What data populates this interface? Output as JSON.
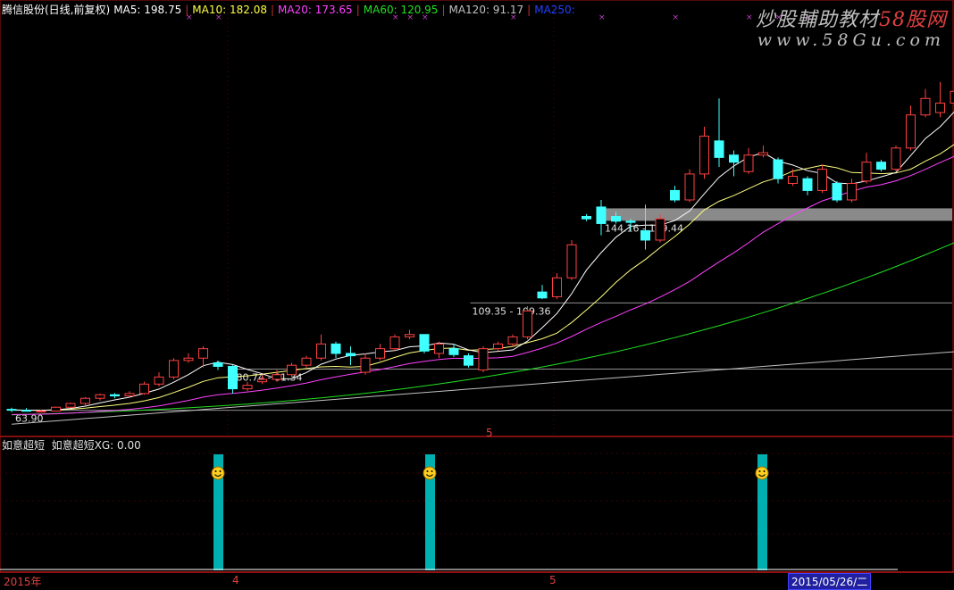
{
  "header": {
    "stock": "腾信股份(日线,前复权)",
    "ma": [
      {
        "label": "MA5: 198.75",
        "color": "#ffffff"
      },
      {
        "label": "MA10: 182.08",
        "color": "#ffff40"
      },
      {
        "label": "MA20: 173.65",
        "color": "#ff40ff"
      },
      {
        "label": "MA60: 120.95",
        "color": "#20e020"
      },
      {
        "label": "MA120: 91.17",
        "color": "#c0c0c0"
      },
      {
        "label": "MA250:",
        "color": "#2040ff"
      }
    ]
  },
  "indicator": {
    "title": "如意超短",
    "value_label": "如意超短XG: 0.00"
  },
  "watermark": {
    "line1_a": "炒股輔助教材",
    "line1_b": "58股网",
    "line2": "www.58Gu.com"
  },
  "x_axis": {
    "year": "2015年",
    "m4": "4",
    "m5": "5",
    "m5_top": "5",
    "date": "2015/05/26/二"
  },
  "colors": {
    "up": "#ff4040",
    "down": "#40ffff",
    "ma5": "#ffffff",
    "ma10": "#ffff80",
    "ma20": "#ff40ff",
    "ma60": "#20e020",
    "ma120": "#c0c0c0",
    "signal": "#00b0b0"
  },
  "chart_data": {
    "type": "candlestick",
    "price_range": [
      60,
      215
    ],
    "candles": [
      {
        "o": 64.3,
        "h": 65,
        "l": 63.1,
        "c": 64.0
      },
      {
        "o": 63.9,
        "h": 64.8,
        "l": 63.5,
        "c": 63.8
      },
      {
        "o": 63.2,
        "h": 64.2,
        "l": 63.0,
        "c": 63.6
      },
      {
        "o": 63.6,
        "h": 65.5,
        "l": 63.5,
        "c": 65.2
      },
      {
        "o": 65.2,
        "h": 67.2,
        "l": 64.8,
        "c": 66.8
      },
      {
        "o": 66.8,
        "h": 69.5,
        "l": 66.0,
        "c": 69.0
      },
      {
        "o": 69.0,
        "h": 71.0,
        "l": 68.0,
        "c": 70.5
      },
      {
        "o": 70.5,
        "h": 71.2,
        "l": 69.0,
        "c": 70.0
      },
      {
        "o": 70.0,
        "h": 72.0,
        "l": 69.5,
        "c": 71.0
      },
      {
        "o": 71.0,
        "h": 76.0,
        "l": 70.5,
        "c": 75.0
      },
      {
        "o": 75.0,
        "h": 80.0,
        "l": 74.0,
        "c": 78.0
      },
      {
        "o": 78.0,
        "h": 86.0,
        "l": 77.0,
        "c": 85.0
      },
      {
        "o": 85.0,
        "h": 88.0,
        "l": 84.0,
        "c": 86.0
      },
      {
        "o": 86.0,
        "h": 91.0,
        "l": 82.0,
        "c": 90.0
      },
      {
        "o": 84.0,
        "h": 85.0,
        "l": 81.0,
        "c": 82.5
      },
      {
        "o": 82.5,
        "h": 83.0,
        "l": 71.0,
        "c": 73.0
      },
      {
        "o": 73.0,
        "h": 76.0,
        "l": 72.0,
        "c": 74.5
      },
      {
        "o": 76.0,
        "h": 79.0,
        "l": 75.0,
        "c": 77.0
      },
      {
        "o": 77.0,
        "h": 81.0,
        "l": 76.0,
        "c": 79.0
      },
      {
        "o": 79.0,
        "h": 84.0,
        "l": 78.0,
        "c": 83.0
      },
      {
        "o": 83.0,
        "h": 87.0,
        "l": 82.0,
        "c": 86.0
      },
      {
        "o": 86.0,
        "h": 96.0,
        "l": 85.0,
        "c": 92.0
      },
      {
        "o": 92.0,
        "h": 93.0,
        "l": 86.0,
        "c": 88.0
      },
      {
        "o": 88.0,
        "h": 91.0,
        "l": 83.0,
        "c": 87.0
      },
      {
        "o": 80.0,
        "h": 88.0,
        "l": 79.0,
        "c": 86.0
      },
      {
        "o": 86.0,
        "h": 92.0,
        "l": 85.0,
        "c": 90.0
      },
      {
        "o": 90.0,
        "h": 96.0,
        "l": 89.0,
        "c": 95.0
      },
      {
        "o": 95.0,
        "h": 98.0,
        "l": 94.0,
        "c": 96.0
      },
      {
        "o": 96.0,
        "h": 89.0,
        "l": 88.0,
        "c": 89.0
      },
      {
        "o": 88.0,
        "h": 93.0,
        "l": 86.0,
        "c": 92.0
      },
      {
        "o": 90.0,
        "h": 92.0,
        "l": 86.5,
        "c": 87.5
      },
      {
        "o": 87.0,
        "h": 88.0,
        "l": 82.0,
        "c": 83.0
      },
      {
        "o": 81.0,
        "h": 91.0,
        "l": 80.0,
        "c": 90.0
      },
      {
        "o": 90.0,
        "h": 93.0,
        "l": 89.0,
        "c": 92.0
      },
      {
        "o": 92.0,
        "h": 96.0,
        "l": 91.0,
        "c": 95.0
      },
      {
        "o": 95.0,
        "h": 108.0,
        "l": 94.0,
        "c": 106.0
      },
      {
        "o": 114.0,
        "h": 117.0,
        "l": 111.0,
        "c": 111.5
      },
      {
        "o": 112.0,
        "h": 122.0,
        "l": 111.0,
        "c": 120.0
      },
      {
        "o": 120.0,
        "h": 136.0,
        "l": 119.0,
        "c": 134.0
      },
      {
        "o": 146.0,
        "h": 147.0,
        "l": 144.0,
        "c": 145.0
      },
      {
        "o": 150.0,
        "h": 153.0,
        "l": 138.0,
        "c": 143.0
      },
      {
        "o": 146.0,
        "h": 148.0,
        "l": 143.0,
        "c": 144.0
      },
      {
        "o": 144.0,
        "h": 145.0,
        "l": 140.0,
        "c": 143.5
      },
      {
        "o": 140.0,
        "h": 151.0,
        "l": 132.0,
        "c": 136.0
      },
      {
        "o": 136.0,
        "h": 147.0,
        "l": 135.0,
        "c": 145.0
      },
      {
        "o": 157.0,
        "h": 159.0,
        "l": 152.0,
        "c": 153.0
      },
      {
        "o": 153.0,
        "h": 166.0,
        "l": 152.0,
        "c": 164.0
      },
      {
        "o": 164.0,
        "h": 184.0,
        "l": 162.0,
        "c": 180.0
      },
      {
        "o": 178.0,
        "h": 196.0,
        "l": 167.0,
        "c": 171.0
      },
      {
        "o": 172.0,
        "h": 174.0,
        "l": 163.0,
        "c": 169.0
      },
      {
        "o": 165.0,
        "h": 175.0,
        "l": 164.0,
        "c": 172.0
      },
      {
        "o": 172.0,
        "h": 176.0,
        "l": 171.0,
        "c": 173.0
      },
      {
        "o": 170.0,
        "h": 171.0,
        "l": 160.0,
        "c": 162.0
      },
      {
        "o": 160.0,
        "h": 166.0,
        "l": 159.0,
        "c": 163.0
      },
      {
        "o": 162.0,
        "h": 163.0,
        "l": 155.0,
        "c": 157.0
      },
      {
        "o": 157.0,
        "h": 168.0,
        "l": 156.0,
        "c": 166.0
      },
      {
        "o": 160.0,
        "h": 161.0,
        "l": 152.0,
        "c": 153.0
      },
      {
        "o": 153.0,
        "h": 162.0,
        "l": 152.0,
        "c": 160.0
      },
      {
        "o": 161.0,
        "h": 173.0,
        "l": 160.0,
        "c": 169.0
      },
      {
        "o": 169.0,
        "h": 170.0,
        "l": 165.0,
        "c": 166.0
      },
      {
        "o": 166.0,
        "h": 176.0,
        "l": 165.0,
        "c": 175.0
      },
      {
        "o": 175.0,
        "h": 193.0,
        "l": 174.0,
        "c": 189.0
      },
      {
        "o": 189.0,
        "h": 200.0,
        "l": 188.0,
        "c": 196.0
      },
      {
        "o": 190.0,
        "h": 203.0,
        "l": 188.0,
        "c": 194.0
      },
      {
        "o": 194.0,
        "h": 207.0,
        "l": 193.0,
        "c": 199.0
      },
      {
        "o": 199.0,
        "h": 212.0,
        "l": 197.0,
        "c": 203.0
      },
      {
        "o": 203.0,
        "h": 212.0,
        "l": 201.0,
        "c": 210.0
      },
      {
        "o": 210.0,
        "h": 210.5,
        "l": 191.0,
        "c": 193.0
      }
    ],
    "bands": [
      {
        "label": "144.16 - 149.44",
        "low": 144.16,
        "high": 149.44,
        "from": 40
      },
      {
        "label": "109.35 - 109.36",
        "low": 109.35,
        "high": 109.36,
        "from": 31
      },
      {
        "label": "80.74 - 81.34",
        "low": 80.74,
        "high": 81.34,
        "from": 15
      },
      {
        "label": "63.90",
        "low": 63.9,
        "high": 63.9,
        "from": 0
      }
    ],
    "signals": [
      14,
      28,
      50
    ],
    "signal_markers": [
      12,
      14,
      26,
      27,
      28,
      34,
      40,
      45,
      50,
      52,
      54
    ]
  }
}
